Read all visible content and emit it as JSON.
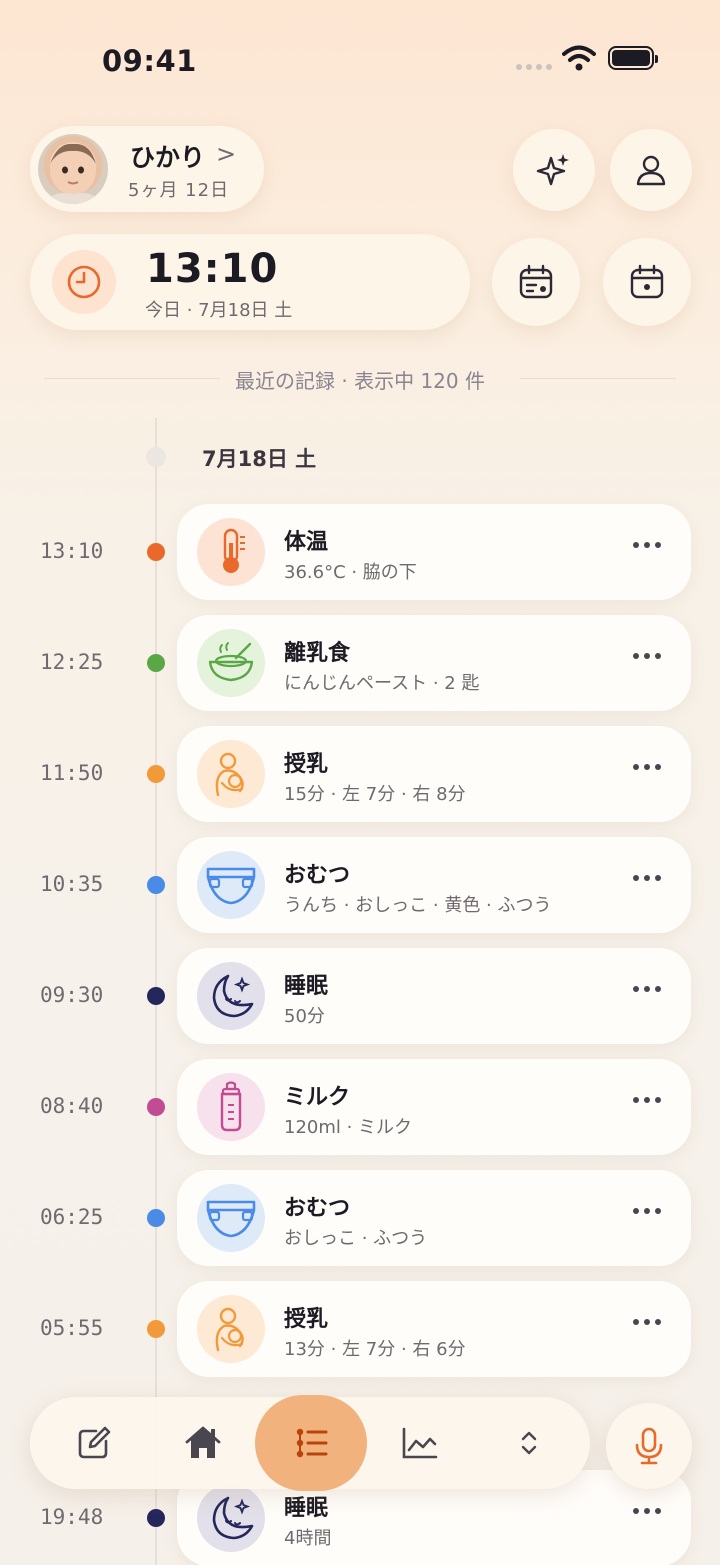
{
  "status_bar": {
    "time": "09:41"
  },
  "profile": {
    "name": "ひかり",
    "chevron": ">",
    "age": "5ヶ月 12日"
  },
  "header_buttons": {
    "sparkle_icon": "sparkle-icon",
    "account_icon": "person-icon"
  },
  "now": {
    "time": "13:10",
    "date": "今日 · 7月18日 土"
  },
  "calendar_buttons": [
    "calendar-schedule-icon",
    "calendar-day-icon"
  ],
  "recent": {
    "label": "最近の記録 · 表示中 120 件"
  },
  "date_header": "7月18日 土",
  "colors": {
    "accent": "#f2b27e",
    "orange": "#e8692a",
    "green": "#5aa845",
    "amber": "#f29a3a",
    "blue": "#4a8be8",
    "navy": "#25275c",
    "pink": "#c24c94"
  },
  "records": [
    {
      "time": "13:10",
      "title": "体温",
      "detail": "36.6°C · 脇の下",
      "icon": "thermometer-icon",
      "color": "#e8692a",
      "bg": "#fde3d4"
    },
    {
      "time": "12:25",
      "title": "離乳食",
      "detail": "にんじんペースト · 2 匙",
      "icon": "baby-food-bowl-icon",
      "color": "#5aa845",
      "bg": "#e5f2dc"
    },
    {
      "time": "11:50",
      "title": "授乳",
      "detail": "15分 · 左 7分 · 右 8分",
      "icon": "breastfeeding-icon",
      "color": "#f29a3a",
      "bg": "#fde9d4"
    },
    {
      "time": "10:35",
      "title": "おむつ",
      "detail": "うんち · おしっこ · 黄色 · ふつう",
      "icon": "diaper-icon",
      "color": "#4a8be8",
      "bg": "#dfeaf9"
    },
    {
      "time": "09:30",
      "title": "睡眠",
      "detail": "50分",
      "icon": "sleep-moon-icon",
      "color": "#25275c",
      "bg": "#e2e0ea"
    },
    {
      "time": "08:40",
      "title": "ミルク",
      "detail": "120ml · ミルク",
      "icon": "baby-bottle-icon",
      "color": "#c24c94",
      "bg": "#f7e1ec"
    },
    {
      "time": "06:25",
      "title": "おむつ",
      "detail": "おしっこ · ふつう",
      "icon": "diaper-icon",
      "color": "#4a8be8",
      "bg": "#dfeaf9"
    },
    {
      "time": "05:55",
      "title": "授乳",
      "detail": "13分 · 左 7分 · 右 6分",
      "icon": "breastfeeding-icon",
      "color": "#f29a3a",
      "bg": "#fde9d4"
    },
    {
      "time": "19:48",
      "title": "睡眠",
      "detail": "4時間",
      "icon": "sleep-moon-icon",
      "color": "#25275c",
      "bg": "#e2e0ea"
    }
  ],
  "nav": [
    {
      "id": "record",
      "icon": "edit-icon"
    },
    {
      "id": "home",
      "icon": "home-icon"
    },
    {
      "id": "timeline",
      "icon": "timeline-list-icon",
      "active": true
    },
    {
      "id": "stats",
      "icon": "chart-icon"
    },
    {
      "id": "more",
      "icon": "expand-icon"
    }
  ],
  "mic": {
    "icon": "microphone-icon"
  }
}
